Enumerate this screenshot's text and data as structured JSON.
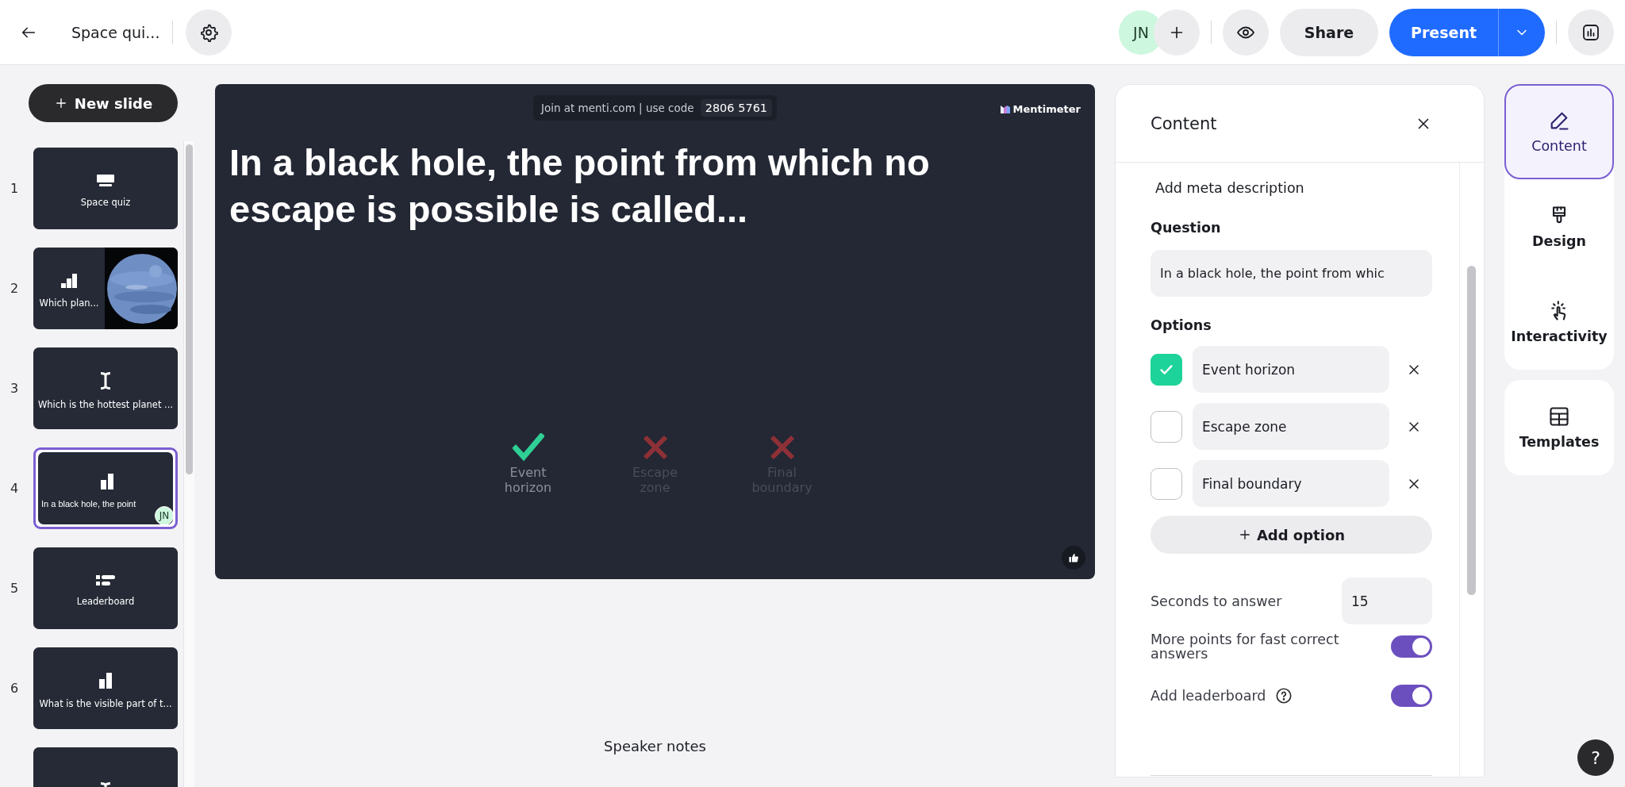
{
  "topbar": {
    "title": "Space qui...",
    "avatar": "JN",
    "share": "Share",
    "present": "Present"
  },
  "sidebar": {
    "new_slide": "New slide",
    "slides": [
      {
        "number": "1",
        "kind": "presentation",
        "title": "Space quiz",
        "selected": false
      },
      {
        "number": "2",
        "kind": "ranking",
        "title": "Which plan...",
        "selected": false,
        "has_image": true
      },
      {
        "number": "3",
        "kind": "open",
        "title": "Which is the hottest planet ...",
        "selected": false
      },
      {
        "number": "4",
        "kind": "bars",
        "title": "In a black hole, the point",
        "selected": true,
        "avatar": "JN"
      },
      {
        "number": "5",
        "kind": "leaderboard",
        "title": "Leaderboard",
        "selected": false
      },
      {
        "number": "6",
        "kind": "bars",
        "title": "What is the visible part of t...",
        "selected": false
      },
      {
        "kind": "open",
        "selected": false
      }
    ]
  },
  "slide": {
    "join_text": "Join at menti.com | use code",
    "code": "2806 5761",
    "brand": "Mentimeter",
    "question": "In a black hole, the point from which no escape is possible is called...",
    "options": [
      {
        "label": "Event horizon",
        "correct": true
      },
      {
        "label": "Escape zone",
        "correct": false
      },
      {
        "label": "Final boundary",
        "correct": false
      }
    ]
  },
  "speaker_notes": "Speaker notes",
  "panel": {
    "title": "Content",
    "meta": "Add meta description",
    "question_label": "Question",
    "question_value": "In a black hole, the point from whic",
    "options_label": "Options",
    "options": [
      {
        "label": "Event horizon",
        "checked": true
      },
      {
        "label": "Escape zone",
        "checked": false
      },
      {
        "label": "Final boundary",
        "checked": false
      }
    ],
    "add_option": "Add option",
    "seconds_label": "Seconds to answer",
    "seconds_value": "15",
    "toggles": [
      {
        "label": "More points for fast correct answers",
        "on": true,
        "help": false
      },
      {
        "label": "Add leaderboard",
        "on": true,
        "help": true
      }
    ]
  },
  "tabs": [
    {
      "kind": "content",
      "label": "Content",
      "selected": true
    },
    {
      "kind": "design",
      "label": "Design",
      "selected": false
    },
    {
      "kind": "interactivity",
      "label": "Interactivity",
      "selected": false
    },
    {
      "kind": "templates",
      "label": "Templates",
      "selected": false
    }
  ],
  "help": "?"
}
